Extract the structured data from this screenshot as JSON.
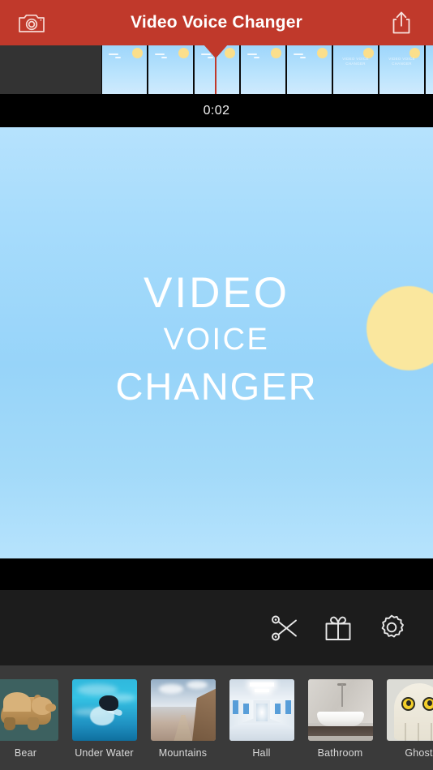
{
  "header": {
    "title": "Video Voice Changer",
    "camera_icon": "camera-icon",
    "share_icon": "share-icon",
    "background_color": "#c0392b"
  },
  "timeline": {
    "current_time": "0:02",
    "playhead_color": "#c0392b",
    "frames": [
      {
        "caption": ""
      },
      {
        "caption": ""
      },
      {
        "caption": ""
      },
      {
        "caption": ""
      },
      {
        "caption": ""
      },
      {
        "caption": "VIDEO VOICE CHANGER"
      },
      {
        "caption": "VIDEO VOICE CHANGER"
      },
      {
        "caption": "VIDEO VOICE CHANGER"
      }
    ]
  },
  "preview": {
    "title_line1": "VIDEO",
    "title_line2": "VOICE",
    "title_line3": "CHANGER",
    "sky_color": "#a7dcfc",
    "sun_color": "#fae79e"
  },
  "toolbar": {
    "items": [
      {
        "name": "trim",
        "icon": "scissors-icon"
      },
      {
        "name": "gift",
        "icon": "gift-icon"
      },
      {
        "name": "settings",
        "icon": "gear-icon"
      }
    ]
  },
  "effects": {
    "items": [
      {
        "label": "Bear",
        "selected": true
      },
      {
        "label": "Under Water",
        "selected": false
      },
      {
        "label": "Mountains",
        "selected": false
      },
      {
        "label": "Hall",
        "selected": false
      },
      {
        "label": "Bathroom",
        "selected": false
      },
      {
        "label": "Ghost",
        "selected": false
      }
    ]
  }
}
